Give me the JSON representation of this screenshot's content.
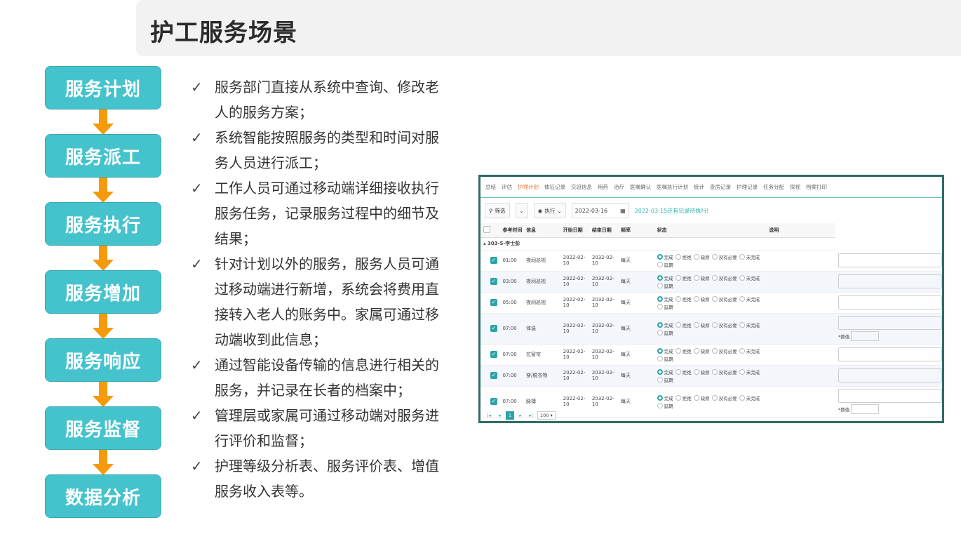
{
  "title": "护工服务场景",
  "flow": {
    "steps": [
      "服务计划",
      "服务派工",
      "服务执行",
      "服务增加",
      "服务响应",
      "服务监督",
      "数据分析"
    ],
    "box_color": "#45c3cd",
    "arrow_color": "#f59a0c"
  },
  "bullets": [
    {
      "check": "✓",
      "lines": [
        "服务部门直接从系统中查询、修改老",
        "人的服务方案；"
      ]
    },
    {
      "check": "✓",
      "lines": [
        "系统智能按照服务的类型和时间对服",
        "务人员进行派工；"
      ]
    },
    {
      "check": "✓",
      "lines": [
        "工作人员可通过移动端详细接收执行",
        "服务任务，记录服务过程中的细节及",
        "结果；"
      ]
    },
    {
      "check": "✓",
      "lines": [
        "针对计划以外的服务，服务人员可通",
        "过移动端进行新增，系统会将费用直",
        "接转入老人的账务中。家属可通过移",
        "动端收到此信息；"
      ]
    },
    {
      "check": "✓",
      "lines": [
        "通过智能设备传输的信息进行相关的",
        "服务，并记录在长者的档案中；"
      ]
    },
    {
      "check": "✓",
      "lines": [
        "管理层或家属可通过移动端对服务进",
        "行评价和监督；"
      ]
    },
    {
      "check": "✓",
      "lines": [
        "护理等级分析表、服务评价表、增值",
        "服务收入表等。"
      ]
    }
  ],
  "app": {
    "tabs": [
      "总结",
      "评估",
      "护理计划",
      "体征记录",
      "交班信息",
      "用药",
      "治疗",
      "医嘱确认",
      "医嘱执行计划",
      "统计",
      "查房记录",
      "护理记录",
      "任务分配",
      "探视",
      "档案打印"
    ],
    "active_tab": 2,
    "toolbar": {
      "filter_label": "筛选",
      "filter_icon": "search-icon",
      "exec_label": "执行",
      "exec_icon": "eye-icon",
      "date_value": "2022-03-16",
      "calendar_icon": "calendar-icon",
      "alert_text": "2022-03-15还有记录待执行!"
    },
    "columns": [
      "参考时间",
      "信息",
      "开始日期",
      "结束日期",
      "频率",
      "状态",
      "说明"
    ],
    "group_label": "303-5-李士彭",
    "status_options": [
      "完成",
      "拒绝",
      "缺席",
      "没有必要",
      "未完成",
      "延期"
    ],
    "rows": [
      {
        "time": "01:00",
        "info": "夜间巡视",
        "start": "2022-02-10",
        "end": "2032-02-10",
        "freq": "每天",
        "extra": ""
      },
      {
        "time": "03:00",
        "info": "夜间巡视",
        "start": "2022-02-10",
        "end": "2032-02-10",
        "freq": "每天",
        "extra": ""
      },
      {
        "time": "05:00",
        "info": "夜间巡视",
        "start": "2022-02-10",
        "end": "2032-02-10",
        "freq": "每天",
        "extra": ""
      },
      {
        "time": "07:00",
        "info": "体温",
        "start": "2022-02-10",
        "end": "2032-02-10",
        "freq": "每天",
        "extra": "*数值"
      },
      {
        "time": "07:00",
        "info": "拉窗帘",
        "start": "2022-02-10",
        "end": "2032-02-10",
        "freq": "每天",
        "extra": ""
      },
      {
        "time": "07:00",
        "info": "穿/脱衣物",
        "start": "2022-02-10",
        "end": "2032-02-10",
        "freq": "每天",
        "extra": ""
      },
      {
        "time": "07:00",
        "info": "脉搏",
        "start": "2022-02-10",
        "end": "2032-02-10",
        "freq": "每天",
        "extra": "*数值"
      }
    ],
    "pager": {
      "first": "|◂",
      "prev": "◂",
      "current": "1",
      "next": "▸",
      "last": "▸|",
      "page_size": "100 ▾"
    }
  }
}
